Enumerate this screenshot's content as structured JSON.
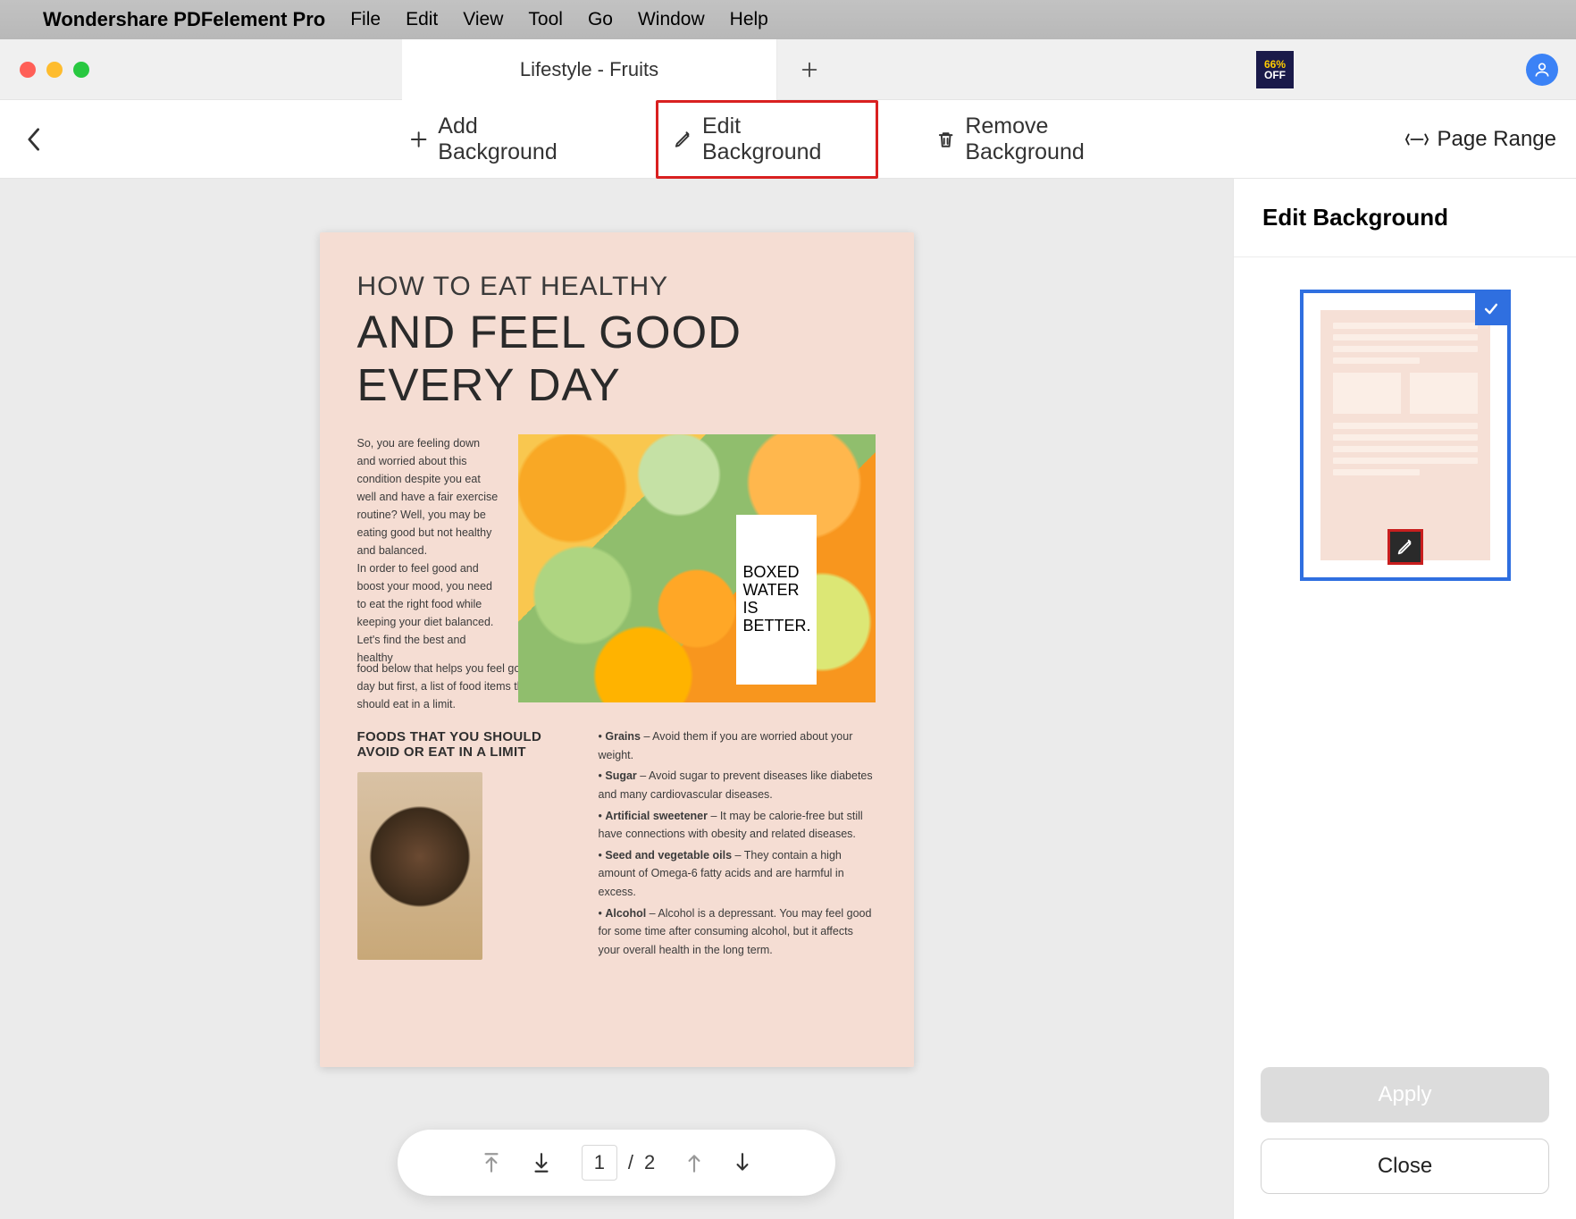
{
  "menubar": {
    "app": "Wondershare PDFelement Pro",
    "items": [
      "File",
      "Edit",
      "View",
      "Tool",
      "Go",
      "Window",
      "Help"
    ]
  },
  "tabbar": {
    "tab_title": "Lifestyle - Fruits",
    "off_pct": "66%",
    "off_txt": "OFF"
  },
  "toolbar": {
    "add_bg": "Add Background",
    "edit_bg": "Edit Background",
    "remove_bg": "Remove Background",
    "page_range": "Page Range"
  },
  "doc": {
    "h1": "HOW TO EAT HEALTHY",
    "h2": "AND FEEL GOOD EVERY DAY",
    "intro": "So, you are feeling down and worried about this condition despite you eat well and have a fair exercise routine? Well, you may be eating good but not healthy and balanced.\nIn order to feel good and boost your mood, you need to eat the right food while keeping your diet balanced. Let's find the best and healthy",
    "intro2": "food below that helps you feel good every day but first, a list of food items that you should eat in a limit.",
    "subhead": "FOODS THAT YOU SHOULD AVOID OR EAT IN A LIMIT",
    "carton_l1": "BOXED",
    "carton_l2": "WATER",
    "carton_l3": "IS",
    "carton_l4": "BETTER.",
    "b1_h": "Grains",
    "b1_t": " – Avoid them if you are worried about your weight.",
    "b2_h": "Sugar",
    "b2_t": " – Avoid sugar to prevent diseases like diabetes and many cardiovascular diseases.",
    "b3_h": "Artificial sweetener",
    "b3_t": " – It may be calorie-free but still have connections with obesity and related diseases.",
    "b4_h": "Seed and vegetable oils",
    "b4_t": " – They contain a high amount of Omega-6 fatty acids and are harmful in excess.",
    "b5_h": "Alcohol",
    "b5_t": " – Alcohol is a depressant. You may feel good for some time after consuming alcohol, but it affects your overall health in the long term."
  },
  "pager": {
    "current": "1",
    "sep": "/",
    "total": "2"
  },
  "sidebar": {
    "title": "Edit Background",
    "apply": "Apply",
    "close": "Close"
  }
}
